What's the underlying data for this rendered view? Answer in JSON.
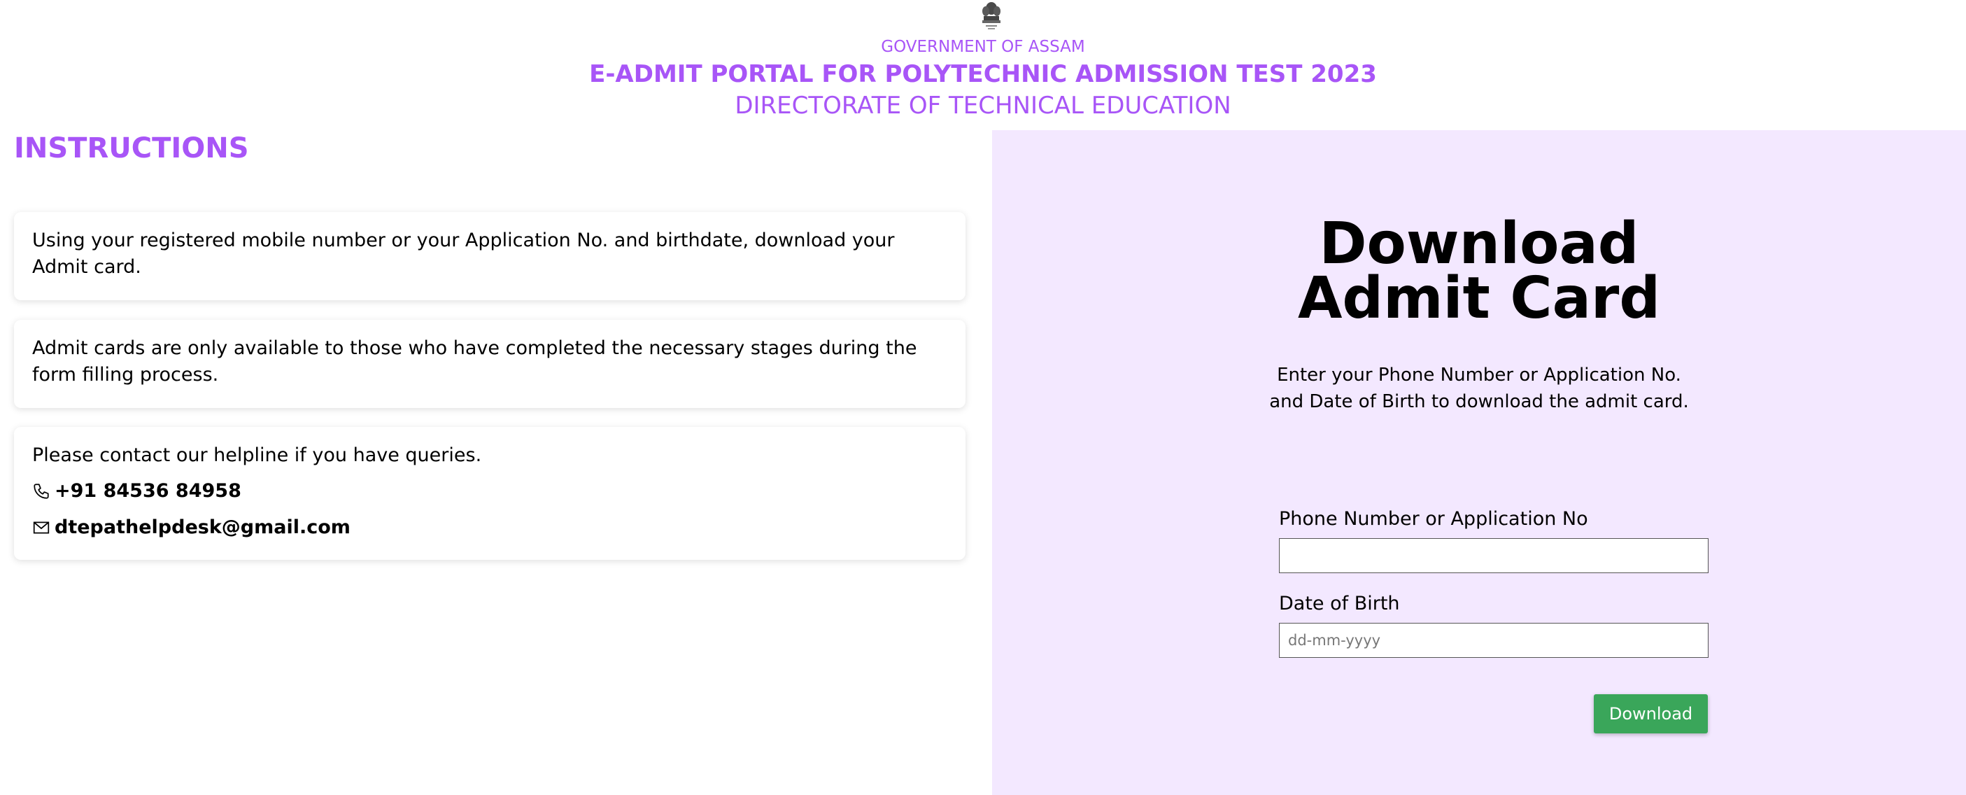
{
  "header": {
    "emblem_icon": "national-emblem-icon",
    "government": "GOVERNMENT OF ASSAM",
    "title": "E-ADMIT PORTAL FOR POLYTECHNIC ADMISSION TEST 2023",
    "directorate": "DIRECTORATE OF TECHNICAL EDUCATION"
  },
  "instructions": {
    "heading": "INSTRUCTIONS",
    "items": [
      "Using your registered mobile number or your Application No. and birthdate, download your Admit card.",
      "Admit cards are only available to those who have completed the necessary stages during the form filling process.",
      "Please contact our helpline if you have queries."
    ],
    "contact": {
      "phone_icon": "phone-icon",
      "phone": "+91 84536 84958",
      "email_icon": "mail-icon",
      "email": "dtepathelpdesk@gmail.com"
    }
  },
  "download": {
    "title_line1": "Download",
    "title_line2": "Admit Card",
    "desc_line1": "Enter your Phone Number or Application No.",
    "desc_line2": "and Date of Birth to download the admit card.",
    "phone_label": "Phone Number or Application No",
    "phone_value": "",
    "dob_label": "Date of Birth",
    "dob_placeholder": "dd-mm-yyyy",
    "dob_value": "",
    "button_label": "Download"
  },
  "colors": {
    "accent": "#a855f7",
    "panel_background": "#f3e8ff",
    "button": "#3aa65a"
  }
}
